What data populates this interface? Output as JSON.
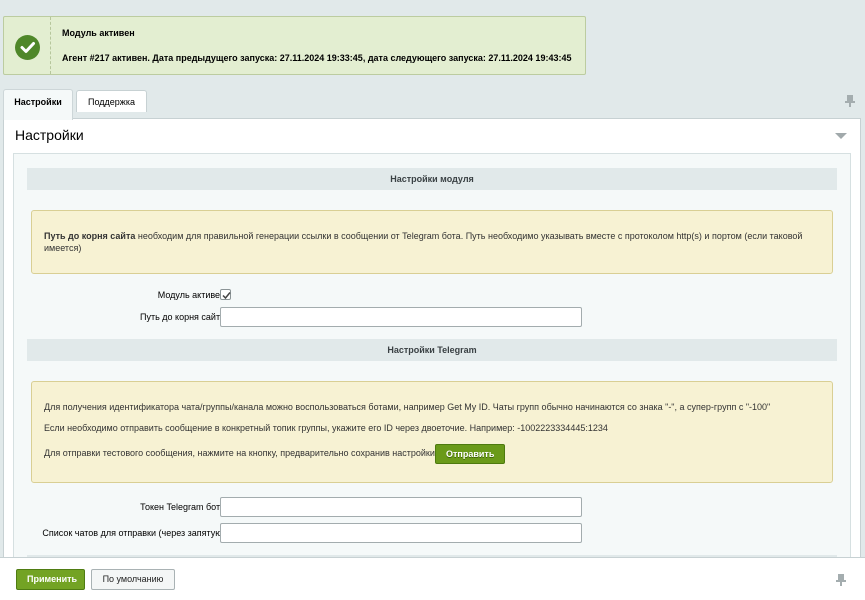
{
  "notice": {
    "title": "Модуль активен",
    "text": "Агент #217 активен. Дата предыдущего запуска: 27.11.2024 19:33:45, дата следующего запуска: 27.11.2024 19:43:45",
    "icon": "checkmark-circle-icon",
    "color": "#4f8729"
  },
  "tabs": [
    {
      "label": "Настройки",
      "active": true
    },
    {
      "label": "Поддержка",
      "active": false
    }
  ],
  "panel": {
    "title": "Настройки"
  },
  "module_section": {
    "header": "Настройки модуля",
    "info_bold": "Путь до корня сайта",
    "info_text": " необходим для правильной генерации ссылки в сообщении от Telegram бота. Путь необходимо указывать вместе с протоколом http(s) и портом (если таковой имеется)",
    "fields": {
      "module_active_label": "Модуль активен",
      "module_active_checked": true,
      "site_root_label": "Путь до корня сайта",
      "site_root_value": ""
    }
  },
  "telegram_section": {
    "header": "Настройки Telegram",
    "info_line1": "Для получения идентификатора чата/группы/канала можно воспользоваться ботами, например Get My ID. Чаты групп обычно начинаются со знака \"-\", а супер-групп с \"-100\"",
    "info_line2": "Если необходимо отправить сообщение в конкретный топик группы, укажите его ID через двоеточие. Например: -1002223334445:1234",
    "info_line3": "Для отправки тестового сообщения, нажмите на кнопку, предварительно сохранив настройки:",
    "send_button": "Отправить",
    "fields": {
      "token_label": "Токен Telegram бота",
      "token_value": "",
      "chats_label": "Список чатов для отправки (через запятую)",
      "chats_value": ""
    }
  },
  "footer": {
    "apply_button": "Применить",
    "defaults_button": "По умолчанию"
  },
  "colors": {
    "accent_green": "#73a324",
    "info_bg": "#f7f2d3",
    "notice_bg": "#e3eed1"
  }
}
